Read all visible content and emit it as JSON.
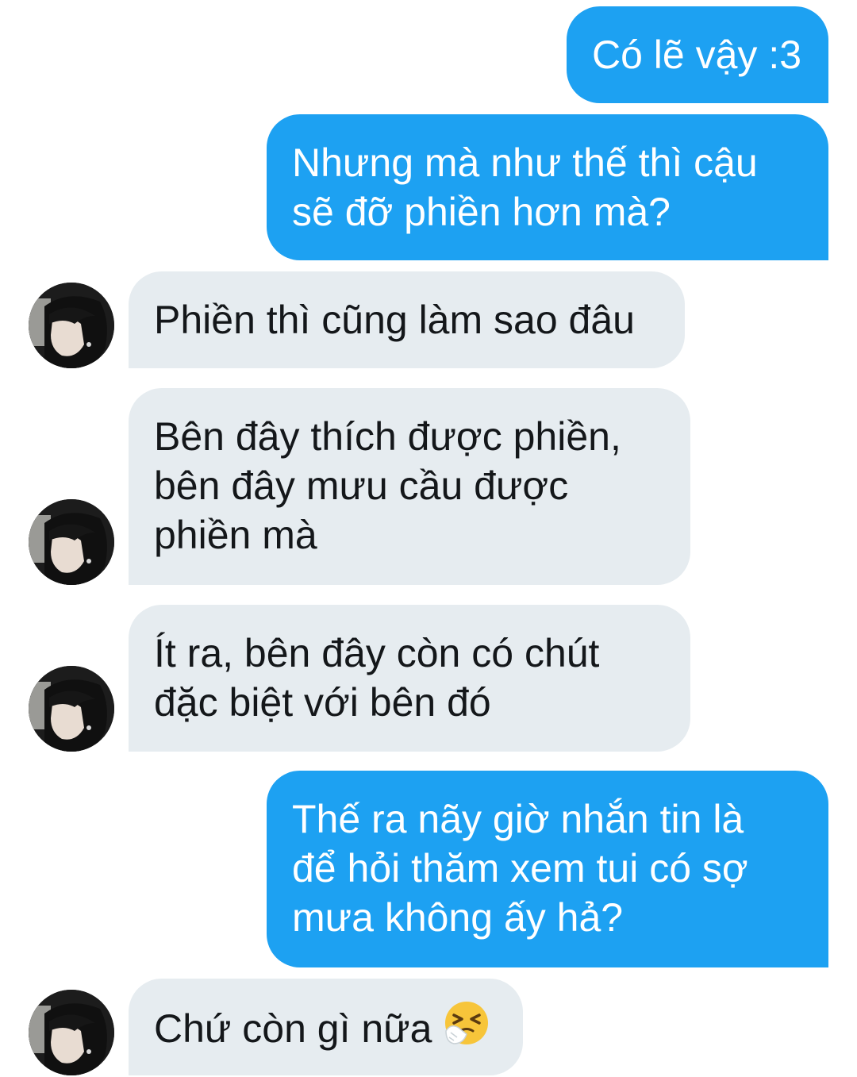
{
  "conversation": {
    "messages": [
      {
        "sender": "me",
        "lines": [
          "Có lẽ vậy :3"
        ]
      },
      {
        "sender": "me",
        "lines": [
          "Nhưng mà như thế thì cậu",
          "sẽ đỡ phiền hơn mà?"
        ]
      },
      {
        "sender": "them",
        "lines": [
          "Phiền thì cũng làm sao đâu"
        ]
      },
      {
        "sender": "them",
        "lines": [
          "Bên đây thích được phiền,",
          "bên đây mưu cầu được",
          "phiền mà"
        ]
      },
      {
        "sender": "them",
        "lines": [
          "Ít ra, bên đây còn có chút",
          "đặc biệt với bên đó"
        ]
      },
      {
        "sender": "me",
        "lines": [
          "Thế ra nãy giờ nhắn tin là",
          "để hỏi thăm xem tui có sợ",
          "mưa không ấy hả?"
        ]
      },
      {
        "sender": "them",
        "lines": [
          "Chứ còn gì nữa"
        ],
        "emoji": "sneezing-face-emoji"
      }
    ]
  },
  "colors": {
    "outgoing_bubble": "#1da1f2",
    "incoming_bubble": "#e6ecf0",
    "outgoing_text": "#ffffff",
    "incoming_text": "#14171a"
  }
}
